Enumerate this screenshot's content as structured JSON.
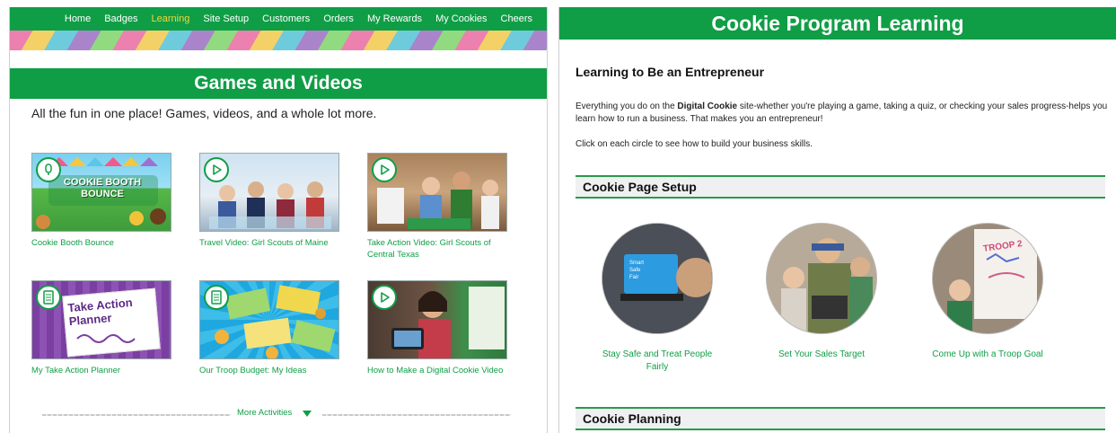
{
  "left": {
    "nav": [
      "Home",
      "Badges",
      "Learning",
      "Site Setup",
      "Customers",
      "Orders",
      "My Rewards",
      "My Cookies",
      "Cheers"
    ],
    "nav_active": "Learning",
    "banner": "Games and Videos",
    "intro": "All the fun in one place! Games, videos, and a whole lot more.",
    "cards": [
      {
        "caption": "Cookie Booth Bounce",
        "icon": "game-icon",
        "thumb_text": "COOKIE BOOTH BOUNCE"
      },
      {
        "caption": "Travel Video: Girl Scouts of Maine",
        "icon": "play-icon"
      },
      {
        "caption": "Take Action Video: Girl Scouts of Central Texas",
        "icon": "play-icon"
      },
      {
        "caption": "My Take Action Planner",
        "icon": "document-icon",
        "thumb_text": "Take Action Planner"
      },
      {
        "caption": "Our Troop Budget: My Ideas",
        "icon": "document-icon"
      },
      {
        "caption": "How to Make a Digital Cookie Video",
        "icon": "play-icon"
      }
    ],
    "more": "More Activities"
  },
  "right": {
    "banner": "Cookie Program Learning",
    "heading": "Learning to Be an Entrepreneur",
    "para_pre": "Everything you do on the ",
    "para_bold": "Digital Cookie",
    "para_post": " site-whether you're playing a game, taking a quiz, or checking your sales progress-helps you learn how to run a business. That makes you an entrepreneur!",
    "para2": "Click on each circle to see how to build your business skills.",
    "sections": [
      "Cookie Page Setup",
      "Cookie Planning"
    ],
    "circles": [
      {
        "label": "Stay Safe and Treat People Fairly",
        "screen_lines": [
          "Smart",
          "Safe",
          "Fair"
        ]
      },
      {
        "label": "Set Your Sales Target"
      },
      {
        "label": "Come Up with a Troop Goal",
        "poster_text": "TROOP 2"
      }
    ]
  },
  "colors": {
    "green": "#0f9e46",
    "active_nav": "#f5d53a"
  }
}
